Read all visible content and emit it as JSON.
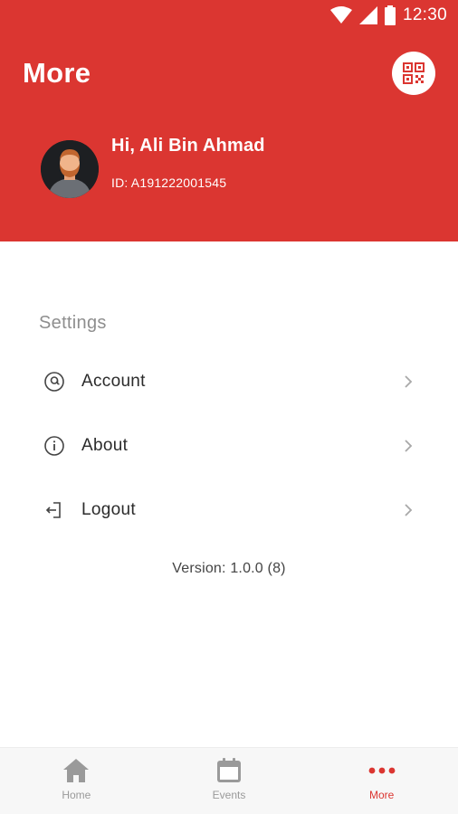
{
  "status_bar": {
    "time": "12:30"
  },
  "header": {
    "title": "More",
    "greeting": "Hi, Ali Bin Ahmad",
    "user_id": "ID: A191222001545"
  },
  "settings": {
    "section_title": "Settings",
    "items": [
      {
        "label": "Account",
        "icon": "account-icon"
      },
      {
        "label": "About",
        "icon": "info-icon"
      },
      {
        "label": "Logout",
        "icon": "logout-icon"
      }
    ]
  },
  "version": "Version: 1.0.0 (8)",
  "bottom_nav": {
    "items": [
      {
        "label": "Home",
        "icon": "home-icon",
        "active": false
      },
      {
        "label": "Events",
        "icon": "calendar-icon",
        "active": false
      },
      {
        "label": "More",
        "icon": "more-dots-icon",
        "active": true
      }
    ]
  },
  "colors": {
    "brand_red": "#DB3631",
    "header_text": "#ffffff",
    "section_title": "#8e8e8e",
    "nav_inactive": "#9a9a9a"
  }
}
